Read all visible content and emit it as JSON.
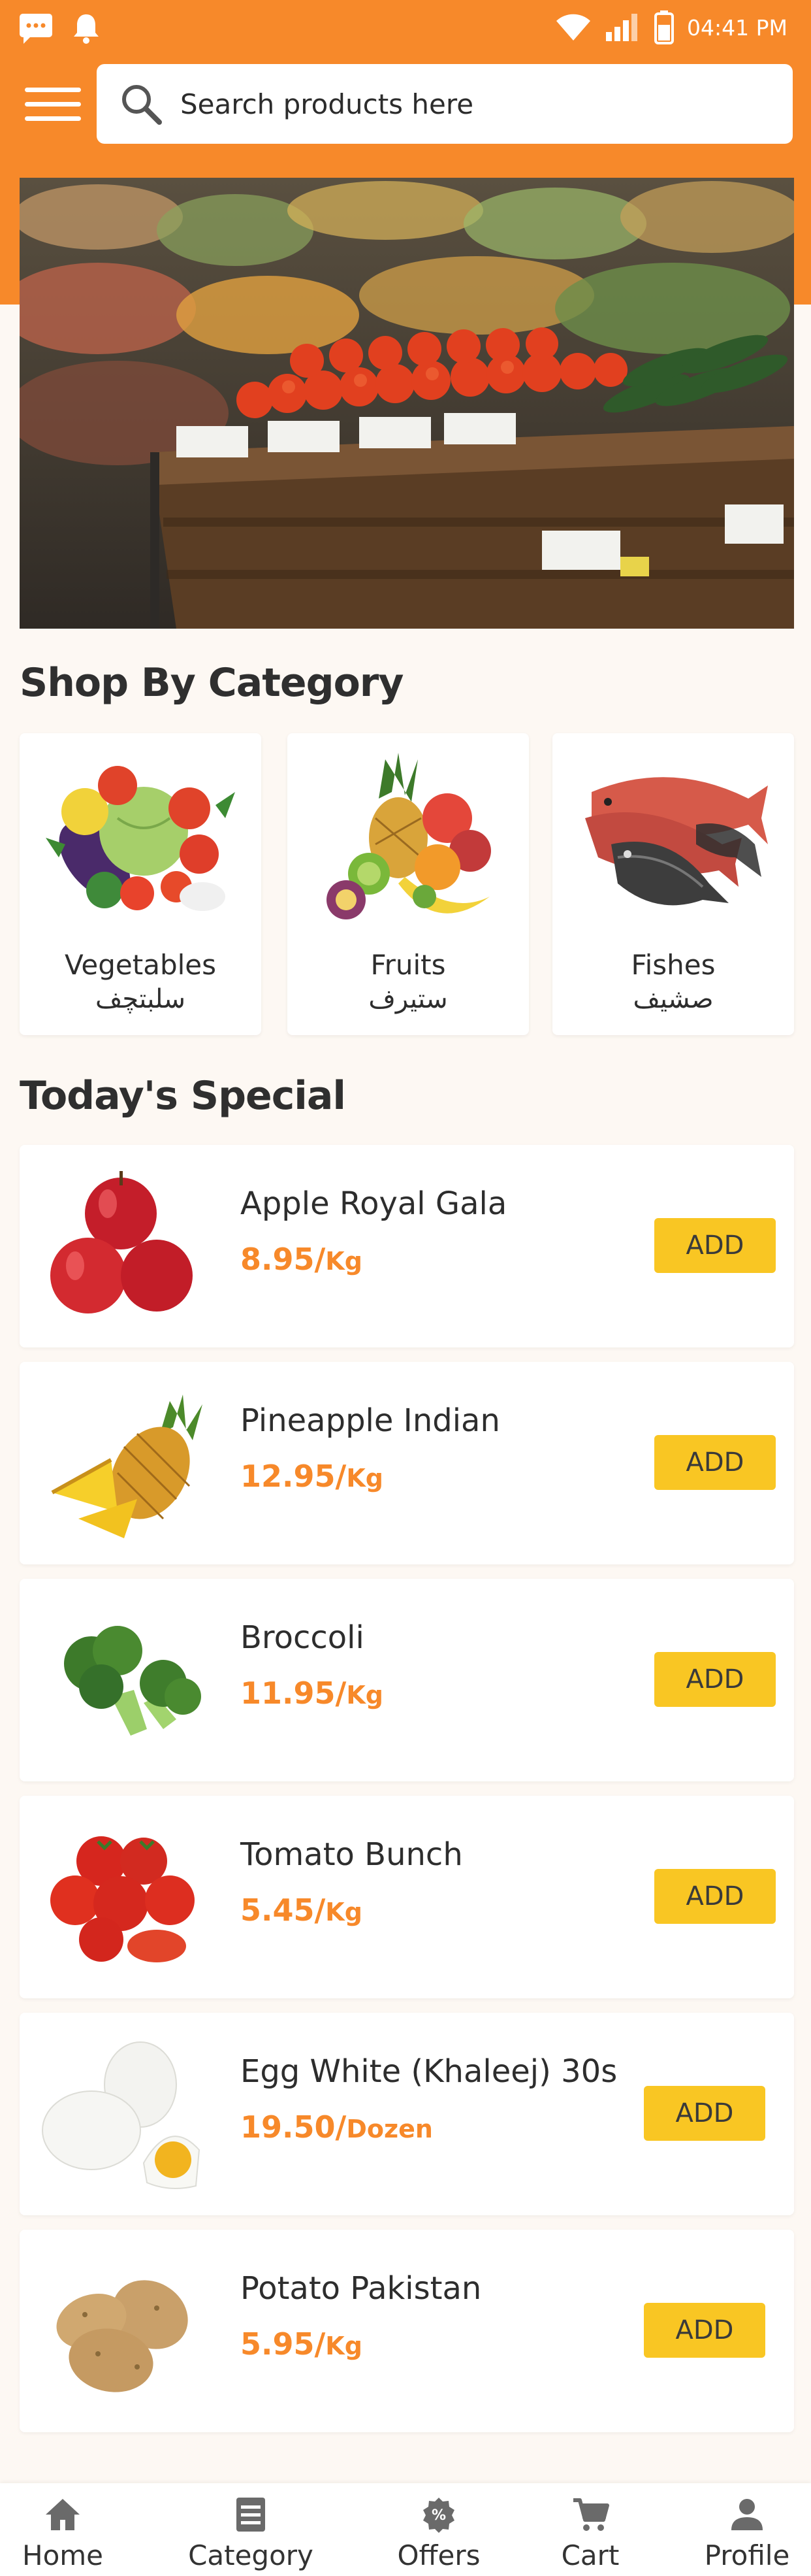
{
  "status_bar": {
    "time": "04:41 PM",
    "icons": [
      "message-icon",
      "notification-bell-icon",
      "wifi-icon",
      "signal-icon",
      "battery-icon"
    ]
  },
  "header": {
    "menu_icon": "hamburger-menu-icon",
    "search": {
      "placeholder": "Search products here",
      "value": "",
      "icon": "search-icon"
    }
  },
  "banner": {
    "image": "supermarket-produce-shelf"
  },
  "categories": {
    "title": "Shop By Category",
    "items": [
      {
        "name": "Vegetables",
        "name_ar": "سلبتچف",
        "image": "vegetables-image"
      },
      {
        "name": "Fruits",
        "name_ar": "ستيرف",
        "image": "fruits-image"
      },
      {
        "name": "Fishes",
        "name_ar": "صشيف",
        "image": "fishes-image"
      }
    ]
  },
  "specials": {
    "title": "Today's Special",
    "add_label": "ADD",
    "items": [
      {
        "name": "Apple Royal Gala",
        "price": "8.95/",
        "unit": "Kg",
        "image": "apple-image"
      },
      {
        "name": "Pineapple Indian",
        "price": "12.95/",
        "unit": "Kg",
        "image": "pineapple-image"
      },
      {
        "name": "Broccoli",
        "price": "11.95/",
        "unit": "Kg",
        "image": "broccoli-image"
      },
      {
        "name": "Tomato Bunch",
        "price": "5.45/",
        "unit": "Kg",
        "image": "tomato-image"
      },
      {
        "name": "Egg White (Khaleej) 30s",
        "price": "19.50/",
        "unit": "Dozen",
        "image": "eggs-image"
      },
      {
        "name": "Potato Pakistan",
        "price": "5.95/",
        "unit": "Kg",
        "image": "potato-image"
      }
    ]
  },
  "bottom_nav": {
    "items": [
      {
        "label": "Home",
        "icon": "home-icon"
      },
      {
        "label": "Category",
        "icon": "category-icon"
      },
      {
        "label": "Offers",
        "icon": "offers-icon"
      },
      {
        "label": "Cart",
        "icon": "cart-icon"
      },
      {
        "label": "Profile",
        "icon": "profile-icon"
      }
    ]
  },
  "colors": {
    "primary": "#f7892a",
    "accent_button": "#f9c623",
    "background": "#fdf8f3"
  }
}
